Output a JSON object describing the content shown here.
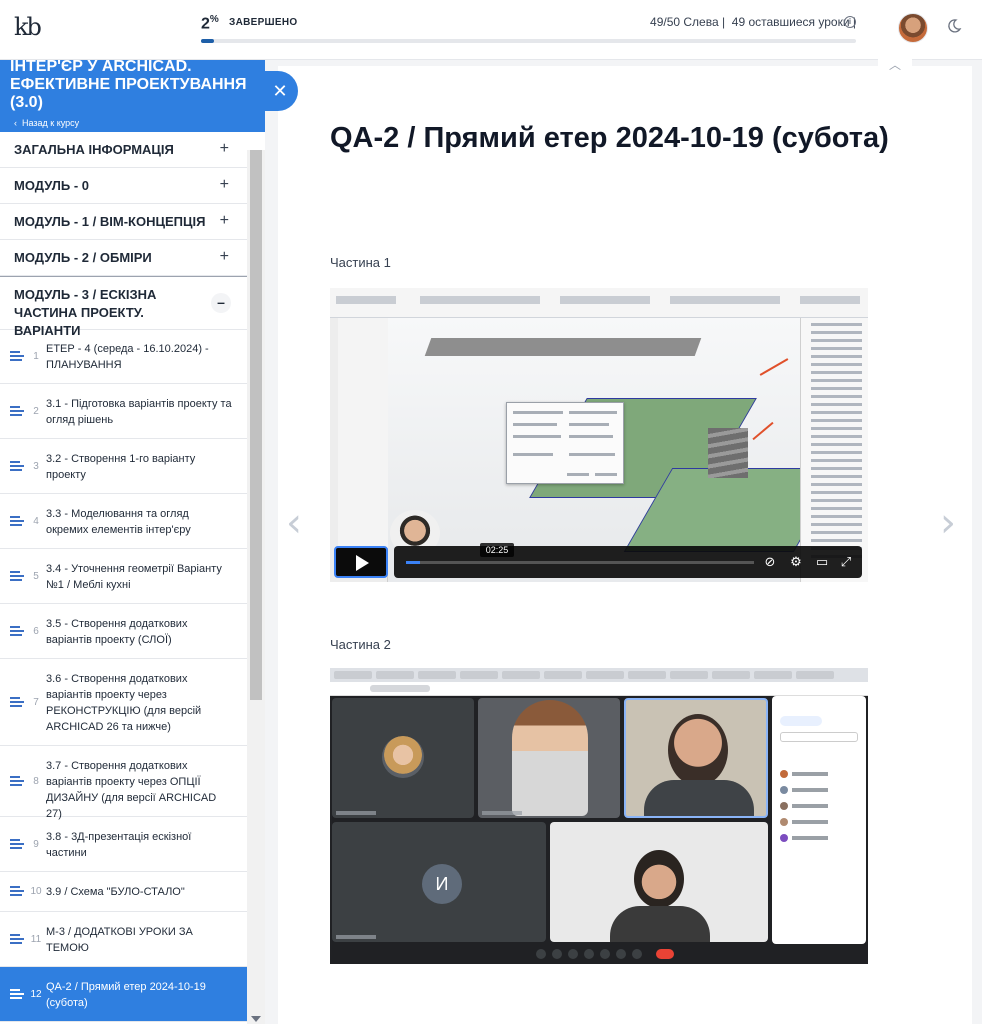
{
  "header": {
    "logo_text": "kb",
    "progress_percent": "2",
    "percent_sign": "%",
    "progress_label": "ЗАВЕРШЕНО",
    "progress_fraction": 0.02,
    "lessons_left": "49/50 Слева",
    "lessons_remaining": "49 оставшиеся уроки",
    "info_icon": "info-icon",
    "theme_icon": "moon-icon"
  },
  "sidebar": {
    "course_title": "ІНТЕР'ЄР У ARCHICAD. ЕФЕКТИВНЕ ПРОЕКТУВАННЯ (3.0)",
    "back_label": "Назад к курсу",
    "close_icon": "close-icon",
    "modules": [
      {
        "title": "ЗАГАЛЬНА ІНФОРМАЦІЯ"
      },
      {
        "title": "МОДУЛЬ - 0"
      },
      {
        "title": "МОДУЛЬ - 1 / BIM-КОНЦЕПЦІЯ"
      },
      {
        "title": "МОДУЛЬ - 2 / ОБМІРИ"
      }
    ],
    "open_module": {
      "title": "МОДУЛЬ - 3 / ЕСКІЗНА ЧАСТИНА ПРОЕКТУ. ВАРІАНТИ"
    },
    "lessons": [
      {
        "num": "1",
        "title": "ЕТЕР - 4 (середа - 16.10.2024) - ПЛАНУВАННЯ"
      },
      {
        "num": "2",
        "title": "3.1 - Підготовка варіантів проекту та огляд рішень"
      },
      {
        "num": "3",
        "title": "3.2 - Створення 1-го варіанту проекту"
      },
      {
        "num": "4",
        "title": "3.3 - Моделювання та огляд окремих елементів інтер'єру"
      },
      {
        "num": "5",
        "title": "3.4 - Уточнення геометрії Варіанту №1 / Меблі кухні"
      },
      {
        "num": "6",
        "title": "3.5 - Створення додаткових варіантів проекту (СЛОЇ)"
      },
      {
        "num": "7",
        "title": "3.6 - Створення додаткових варіантів проекту через РЕКОНСТРУКЦІЮ (для версій ARCHICAD 26 та нижче)"
      },
      {
        "num": "8",
        "title": "3.7 - Створення додаткових варіантів проекту через ОПЦІЇ ДИЗАЙНУ (для версії ARCHICAD 27)"
      },
      {
        "num": "9",
        "title": "3.8 - 3Д-презентація ескізної частини"
      },
      {
        "num": "10",
        "title": "3.9 / Схема \"БУЛО-СТАЛО\""
      },
      {
        "num": "11",
        "title": "М-3 / ДОДАТКОВІ УРОКИ ЗА ТЕМОЮ"
      },
      {
        "num": "12",
        "title": "QA-2 / Прямий етер 2024-10-19 (субота)"
      }
    ]
  },
  "main": {
    "title": "QA-2 / Прямий етер 2024-10-19 (субота)",
    "part1_label": "Частина 1",
    "part2_label": "Частина 2",
    "video1": {
      "time_tooltip": "02:25",
      "played_fraction": 0.04
    },
    "video2": {
      "avatar_letter": "И"
    },
    "prev_arrow": "‹",
    "next_arrow": "›"
  }
}
